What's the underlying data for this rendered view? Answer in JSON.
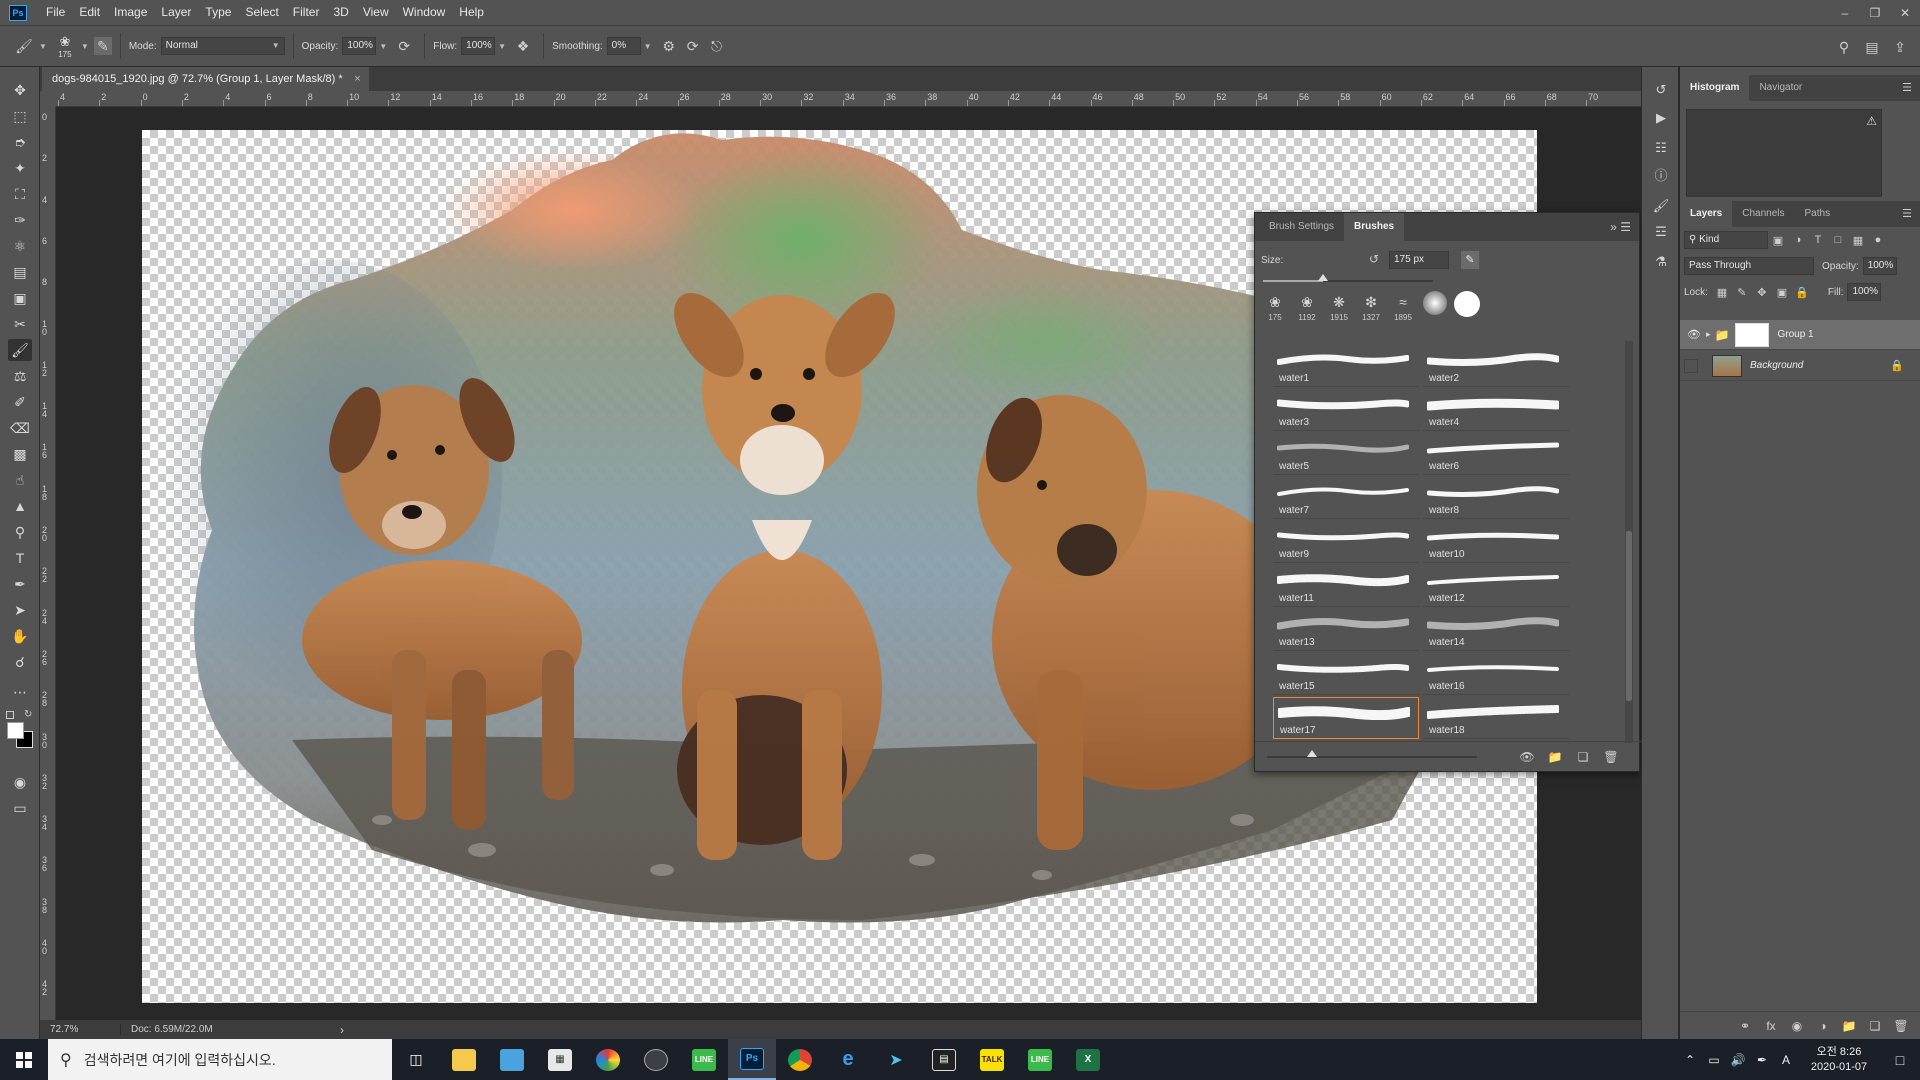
{
  "app": {
    "logo": "Ps",
    "menu": [
      "File",
      "Edit",
      "Image",
      "Layer",
      "Type",
      "Select",
      "Filter",
      "3D",
      "View",
      "Window",
      "Help"
    ],
    "window_controls": [
      "minimize-icon",
      "restore-icon",
      "close-icon"
    ]
  },
  "options": {
    "brush_size": "175",
    "mode_label": "Mode:",
    "mode_value": "Normal",
    "opacity_label": "Opacity:",
    "opacity_value": "100%",
    "flow_label": "Flow:",
    "flow_value": "100%",
    "smoothing_label": "Smoothing:",
    "smoothing_value": "0%"
  },
  "document": {
    "tab_title": "dogs-984015_1920.jpg @ 72.7% (Group 1, Layer Mask/8) *",
    "close": "×"
  },
  "ruler": {
    "top_ticks": [
      "4",
      "2",
      "0",
      "2",
      "4",
      "6",
      "8",
      "10",
      "12",
      "14",
      "16",
      "18",
      "20",
      "22",
      "24",
      "26",
      "28",
      "30",
      "32",
      "34",
      "36",
      "38",
      "40",
      "42",
      "44",
      "46",
      "48",
      "50",
      "52",
      "54",
      "56",
      "58",
      "60",
      "62",
      "64",
      "66",
      "68",
      "70"
    ],
    "left_ticks": [
      "0",
      "2",
      "4",
      "6",
      "8",
      "10",
      "12",
      "14",
      "16",
      "18",
      "20",
      "22",
      "24",
      "26",
      "28",
      "30",
      "32",
      "34",
      "36",
      "38",
      "40",
      "42"
    ]
  },
  "status": {
    "zoom": "72.7%",
    "doc": "Doc: 6.59M/22.0M",
    "arrow": "›"
  },
  "brush_panel": {
    "tabs": [
      "Brush Settings",
      "Brushes"
    ],
    "active_tab": "Brushes",
    "size_label": "Size:",
    "size_value": "175 px",
    "size_fraction": 0.35,
    "recent_sizes": [
      "175",
      "1192",
      "1915",
      "1327",
      "1895"
    ],
    "brushes": [
      "water1",
      "water2",
      "water3",
      "water4",
      "water5",
      "water6",
      "water7",
      "water8",
      "water9",
      "water10",
      "water11",
      "water12",
      "water13",
      "water14",
      "water15",
      "water16",
      "water17",
      "water18"
    ],
    "selected_brush": "water17",
    "accent": "#f0863a"
  },
  "right_panels": {
    "top_tabs": [
      "Histogram",
      "Navigator"
    ],
    "layer_tabs": [
      "Layers",
      "Channels",
      "Paths"
    ],
    "filter_kind": "Kind",
    "blend_mode": "Pass Through",
    "opacity_label": "Opacity:",
    "opacity_value": "100%",
    "lock_label": "Lock:",
    "fill_label": "Fill:",
    "fill_value": "100%",
    "layers": [
      {
        "name": "Group 1",
        "visible": true,
        "selected": true
      },
      {
        "name": "Background",
        "visible": false,
        "selected": false
      }
    ]
  },
  "taskbar": {
    "search_placeholder": "검색하려면 여기에 입력하십시오.",
    "clock_time": "오전 8:26",
    "clock_date": "2020-01-07",
    "ime": "A"
  }
}
